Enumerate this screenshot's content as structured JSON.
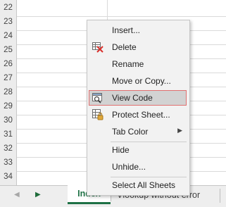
{
  "rows": [
    "22",
    "23",
    "24",
    "25",
    "26",
    "27",
    "28",
    "29",
    "30",
    "31",
    "32",
    "33",
    "34"
  ],
  "context_menu": {
    "insert": "Insert...",
    "delete": "Delete",
    "rename": "Rename",
    "move_copy": "Move or Copy...",
    "view_code": "View Code",
    "protect": "Protect Sheet...",
    "tab_color": "Tab Color",
    "hide": "Hide",
    "unhide": "Unhide...",
    "select_all": "Select All Sheets",
    "highlighted_item": "View Code"
  },
  "sheet_tabs": {
    "active": "Index",
    "other": "Vlookup without error"
  },
  "colors": {
    "accent_green": "#1e7145",
    "highlight_border": "#e07070",
    "menu_background": "#f2f2f2"
  },
  "icons": {
    "delete": "delete-sheet-icon",
    "view_code": "view-code-icon",
    "protect": "protect-sheet-icon",
    "submenu": "chevron-right-icon",
    "nav_prev": "triangle-left-icon",
    "nav_next": "triangle-right-icon"
  }
}
